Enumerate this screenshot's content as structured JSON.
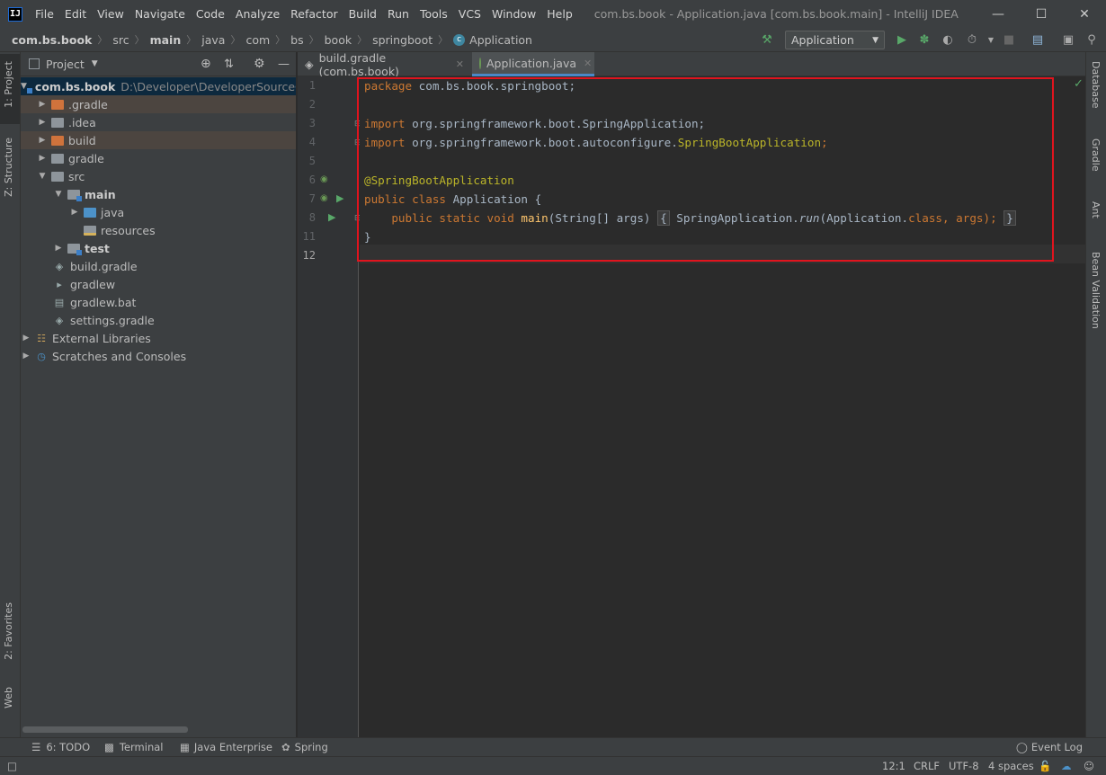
{
  "window": {
    "title": "com.bs.book - Application.java [com.bs.book.main] - IntelliJ IDEA",
    "menu": [
      "File",
      "Edit",
      "View",
      "Navigate",
      "Code",
      "Analyze",
      "Refactor",
      "Build",
      "Run",
      "Tools",
      "VCS",
      "Window",
      "Help"
    ]
  },
  "breadcrumb": [
    "com.bs.book",
    "src",
    "main",
    "java",
    "com",
    "bs",
    "book",
    "springboot",
    "Application"
  ],
  "toolbar": {
    "run_config": "Application"
  },
  "left_strip": {
    "project": "1: Project",
    "structure": "Z: Structure",
    "favorites": "2: Favorites",
    "web": "Web"
  },
  "right_strip": {
    "database": "Database",
    "gradle": "Gradle",
    "ant": "Ant",
    "bean_validation": "Bean Validation"
  },
  "project_panel": {
    "title": "Project",
    "tree": [
      {
        "label": "com.bs.book",
        "path": "D:\\Developer\\DeveloperSourceCo"
      },
      {
        "label": ".gradle"
      },
      {
        "label": ".idea"
      },
      {
        "label": "build"
      },
      {
        "label": "gradle"
      },
      {
        "label": "src"
      },
      {
        "label": "main"
      },
      {
        "label": "java"
      },
      {
        "label": "resources"
      },
      {
        "label": "test"
      },
      {
        "label": "build.gradle"
      },
      {
        "label": "gradlew"
      },
      {
        "label": "gradlew.bat"
      },
      {
        "label": "settings.gradle"
      },
      {
        "label": "External Libraries"
      },
      {
        "label": "Scratches and Consoles"
      }
    ]
  },
  "editor": {
    "tabs": [
      "build.gradle (com.bs.book)",
      "Application.java"
    ],
    "line_numbers": [
      "1",
      "2",
      "3",
      "4",
      "5",
      "6",
      "7",
      "8",
      "11",
      "12"
    ],
    "code": {
      "l1_kw": "package",
      "l1_rest": " com.bs.book.springboot;",
      "l3_kw": "import",
      "l3_rest": " org.springframework.boot.SpringApplication;",
      "l4_kw": "import",
      "l4_rest": " org.springframework.boot.autoconfigure.",
      "l4_ann": "SpringBootApplication",
      "l4_end": ";",
      "l6_ann": "@SpringBootApplication",
      "l7_kw": "public class",
      "l7_rest": " Application {",
      "l8_indent": "    ",
      "l8_kw": "public static void",
      "l8_sp": " ",
      "l8_fn": "main",
      "l8_params": "(String[] args)",
      "l8_fold_open": "{",
      "l8_call": " SpringApplication.",
      "l8_run": "run",
      "l8_args": "(Application.",
      "l8_class": "class",
      "l8_comma": ", args);",
      "l8_fold_close": "}",
      "l11": "}"
    }
  },
  "bottom_tools": [
    "6: TODO",
    "Terminal",
    "Java Enterprise",
    "Spring",
    "Event Log"
  ],
  "status": {
    "position": "12:1",
    "line_sep": "CRLF",
    "encoding": "UTF-8",
    "indent": "4 spaces"
  },
  "colors": {
    "highlight_box": "#e0141e",
    "accent_tab": "#4a88c7",
    "keyword": "#cc7832",
    "annotation": "#bbb529"
  }
}
